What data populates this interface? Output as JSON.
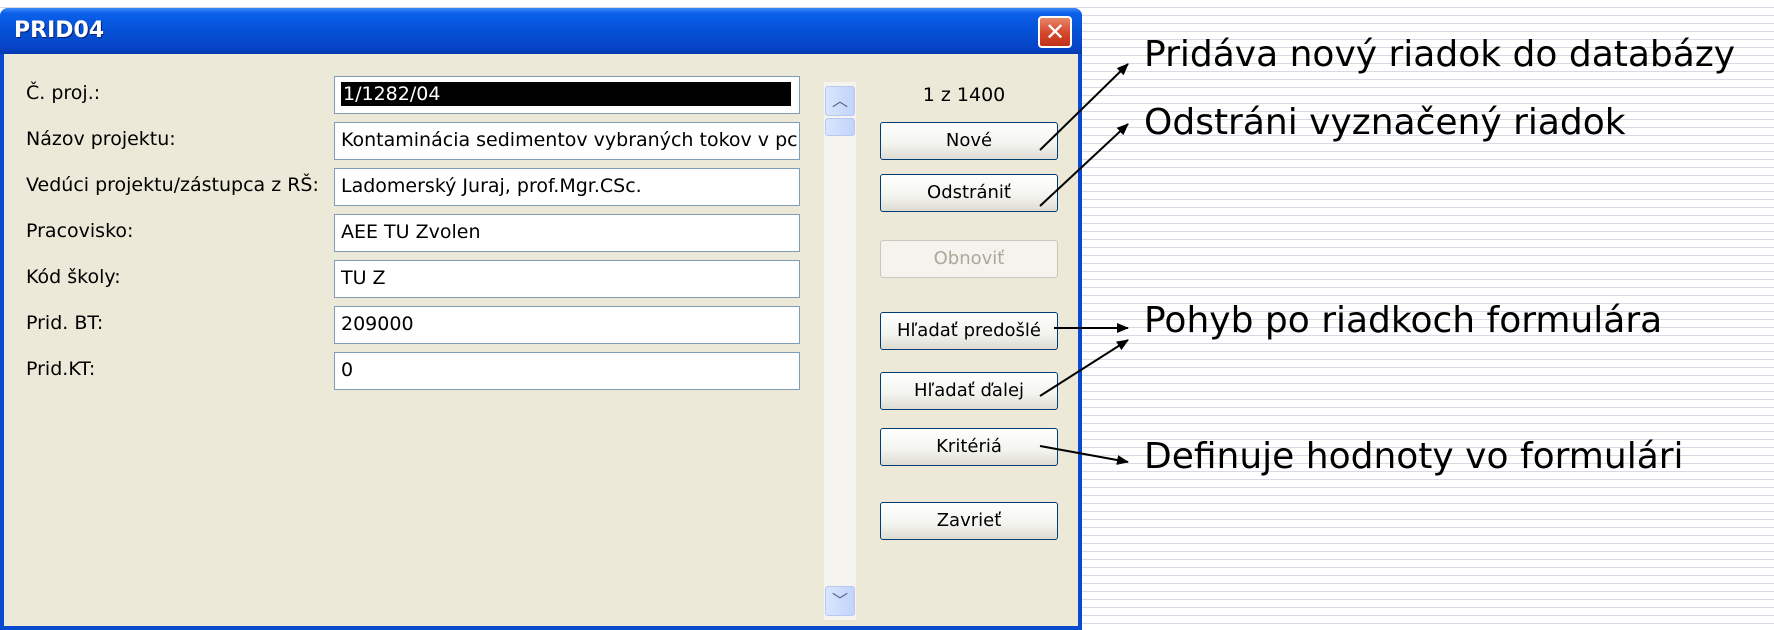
{
  "window": {
    "title": "PRID04",
    "close_glyph": "✕",
    "counter": "1 z 1400"
  },
  "fields": [
    {
      "label": "Č. proj.:",
      "value": "1/1282/04",
      "selected": true
    },
    {
      "label": "Názov projektu:",
      "value": "Kontaminácia sedimentov vybraných tokov v pc"
    },
    {
      "label": "Vedúci projektu/zástupca z RŠ:",
      "value": "Ladomerský Juraj, prof.Mgr.CSc."
    },
    {
      "label": "Pracovisko:",
      "value": "AEE TU Zvolen"
    },
    {
      "label": "Kód školy:",
      "value": "TU Z"
    },
    {
      "label": "Prid. BT:",
      "value": "209000"
    },
    {
      "label": "Prid.KT:",
      "value": "0"
    }
  ],
  "buttons": {
    "new": "Nové",
    "delete": "Odstrániť",
    "refresh": "Obnoviť",
    "find_prev": "Hľadať predošlé",
    "find_next": "Hľadať ďalej",
    "criteria": "Kritériá",
    "close": "Zavrieť"
  },
  "scrollbar": {
    "up_glyph": "︿",
    "down_glyph": "﹀"
  },
  "annotations": {
    "new": "Pridáva nový riadok do databázy",
    "delete": "Odstráni vyznačený riadok",
    "navigate": "Pohyb po riadkoch formulára",
    "criteria": "Definuje hodnoty vo formulári"
  },
  "colors": {
    "titlebar": "#0551d6",
    "window_bg": "#ece9d8",
    "close_button": "#d4452a"
  }
}
